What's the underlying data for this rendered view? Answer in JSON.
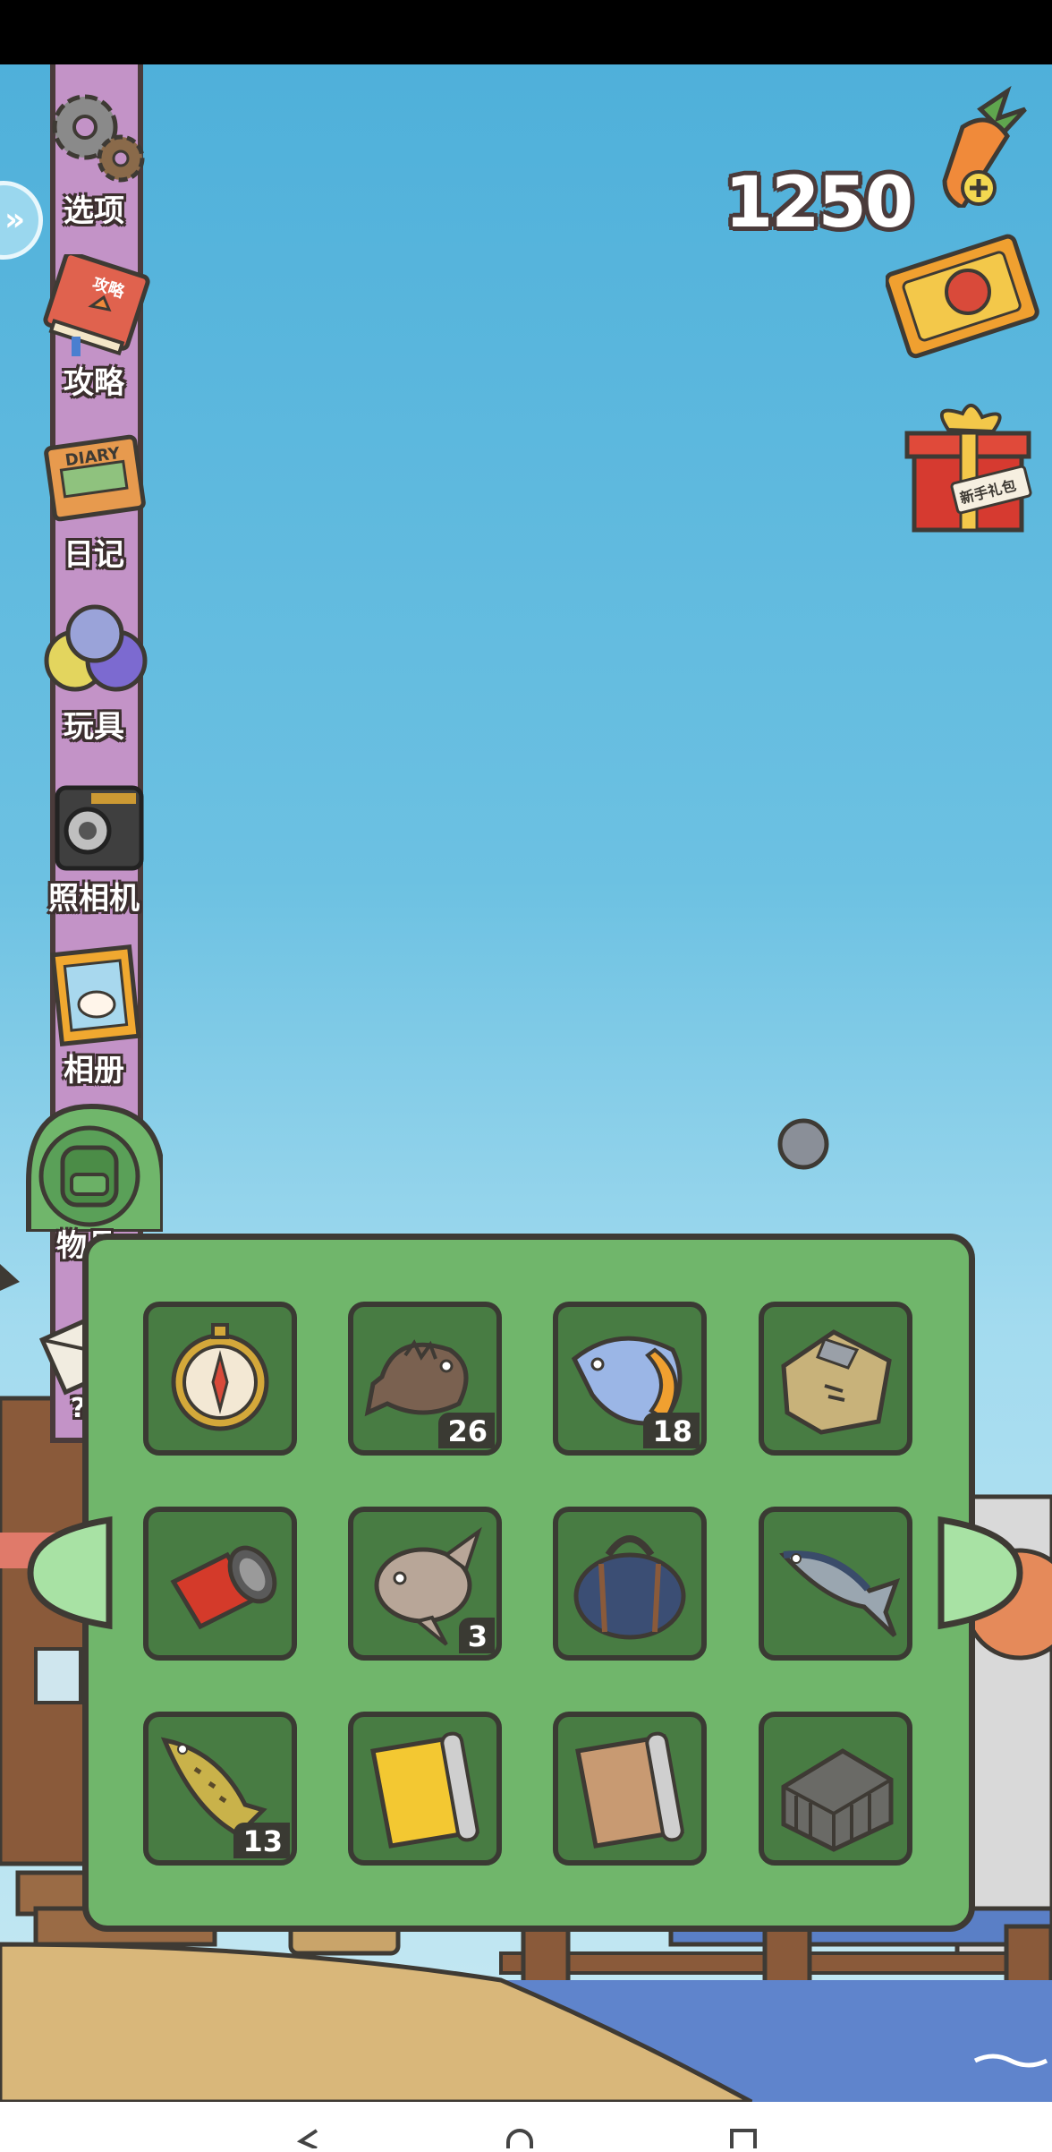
{
  "currency": {
    "amount": "1250",
    "add_icon": "carrot-plus-icon"
  },
  "top_right": [
    {
      "name": "ticket-icon"
    },
    {
      "name": "gift-box-icon",
      "text": "新手礼包"
    }
  ],
  "sidebar": {
    "items": [
      {
        "label": "选项",
        "icon": "gear-icon"
      },
      {
        "label": "攻略",
        "icon": "guide-book-icon",
        "book_text": "攻略"
      },
      {
        "label": "日记",
        "icon": "diary-icon",
        "book_text": "DIARY"
      },
      {
        "label": "玩具",
        "icon": "toy-balls-icon"
      },
      {
        "label": "照相机",
        "icon": "camera-icon"
      },
      {
        "label": "相册",
        "icon": "photo-album-icon"
      },
      {
        "label": "物品",
        "icon": "backpack-icon"
      },
      {
        "label": "???",
        "icon": "letter-icon"
      }
    ]
  },
  "inventory": {
    "slots": [
      {
        "item": "compass-icon",
        "count": ""
      },
      {
        "item": "scorpionfish-icon",
        "count": "26"
      },
      {
        "item": "tropical-fish-icon",
        "count": "18"
      },
      {
        "item": "cloth-bundle-icon",
        "count": ""
      },
      {
        "item": "flashlight-icon",
        "count": ""
      },
      {
        "item": "sunfish-icon",
        "count": "3"
      },
      {
        "item": "duffel-bag-icon",
        "count": ""
      },
      {
        "item": "tuna-icon",
        "count": ""
      },
      {
        "item": "bass-fish-icon",
        "count": "13"
      },
      {
        "item": "yellow-scroll-icon",
        "count": ""
      },
      {
        "item": "brown-scroll-icon",
        "count": ""
      },
      {
        "item": "wood-crate-icon",
        "count": ""
      }
    ]
  },
  "colors": {
    "sky": "#6cc1e2",
    "panel": "#70b66b",
    "slot": "#487c43",
    "sidebar": "#c393c7"
  }
}
